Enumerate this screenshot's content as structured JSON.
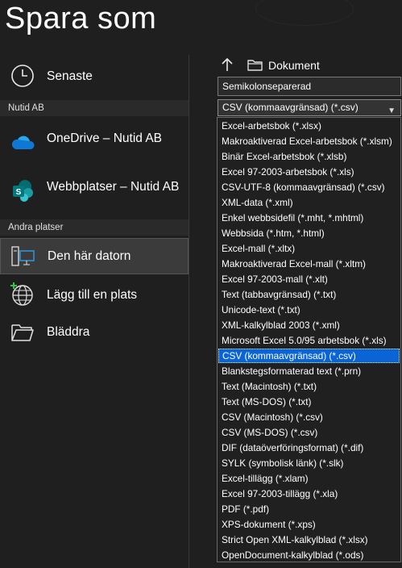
{
  "window": {
    "title": "Spara som"
  },
  "nav": {
    "recent": "Senaste",
    "org_header": "Nutid AB",
    "onedrive": "OneDrive – Nutid AB",
    "sites": "Webbplatser – Nutid AB",
    "other_header": "Andra platser",
    "this_pc": "Den här datorn",
    "add_place": "Lägg till en plats",
    "browse": "Bläddra"
  },
  "location": {
    "breadcrumb": "Dokument"
  },
  "filename": {
    "value": "Semikolonseparerad"
  },
  "filetype": {
    "selected": "CSV (kommaavgränsad) (*.csv)",
    "options": [
      "Excel-arbetsbok (*.xlsx)",
      "Makroaktiverad Excel-arbetsbok (*.xlsm)",
      "Binär Excel-arbetsbok (*.xlsb)",
      "Excel 97-2003-arbetsbok (*.xls)",
      "CSV-UTF-8 (kommaavgränsad) (*.csv)",
      "XML-data (*.xml)",
      "Enkel webbsidefil (*.mht, *.mhtml)",
      "Webbsida (*.htm, *.html)",
      "Excel-mall (*.xltx)",
      "Makroaktiverad Excel-mall (*.xltm)",
      "Excel 97-2003-mall (*.xlt)",
      "Text (tabbavgränsad) (*.txt)",
      "Unicode-text (*.txt)",
      "XML-kalkylblad 2003 (*.xml)",
      "Microsoft Excel 5.0/95 arbetsbok (*.xls)",
      "CSV (kommaavgränsad) (*.csv)",
      "Blankstegsformaterad text (*.prn)",
      "Text (Macintosh) (*.txt)",
      "Text (MS-DOS) (*.txt)",
      "CSV (Macintosh) (*.csv)",
      "CSV (MS-DOS) (*.csv)",
      "DIF (dataöverföringsformat) (*.dif)",
      "SYLK (symbolisk länk) (*.slk)",
      "Excel-tillägg (*.xlam)",
      "Excel 97-2003-tillägg (*.xla)",
      "PDF (*.pdf)",
      "XPS-dokument (*.xps)",
      "Strict Open XML-kalkylblad (*.xlsx)",
      "OpenDocument-kalkylblad (*.ods)"
    ],
    "selected_index": 15
  },
  "colors": {
    "selection": "#0a64d6",
    "background": "#1f1f1f",
    "onedrive": "#0f78d4",
    "sharepoint": "#037c6e"
  },
  "icons": [
    "clock-icon",
    "onedrive-cloud-icon",
    "sharepoint-icon",
    "computer-icon",
    "globe-add-icon",
    "folder-open-icon",
    "up-arrow-icon",
    "folder-icon",
    "chevron-down-icon"
  ]
}
